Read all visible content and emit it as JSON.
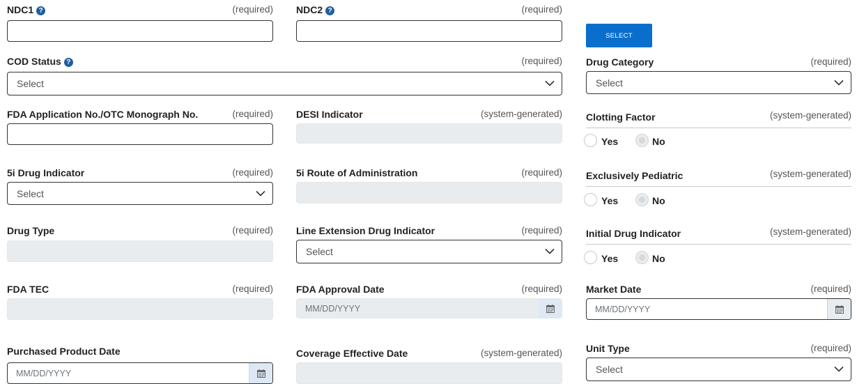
{
  "fields": {
    "ndc1": {
      "label": "NDC1",
      "req": "(required)",
      "value": ""
    },
    "ndc2": {
      "label": "NDC2",
      "req": "(required)",
      "value": ""
    },
    "select_button": "SELECT",
    "cod_status": {
      "label": "COD Status",
      "req": "(required)",
      "selected": "Select"
    },
    "drug_category": {
      "label": "Drug Category",
      "req": "(required)",
      "selected": "Select"
    },
    "fda_app_no": {
      "label": "FDA Application No./OTC Monograph No.",
      "req": "(required)",
      "value": ""
    },
    "desi_indicator": {
      "label": "DESI Indicator",
      "req": "(system-generated)"
    },
    "clotting_factor": {
      "label": "Clotting Factor",
      "req": "(system-generated)",
      "yes": "Yes",
      "no": "No"
    },
    "five_i_drug": {
      "label": "5i Drug Indicator",
      "req": "(required)",
      "selected": "Select"
    },
    "five_i_route": {
      "label": "5i Route of Administration",
      "req": "(required)"
    },
    "excl_pediatric": {
      "label": "Exclusively Pediatric",
      "req": "(system-generated)",
      "yes": "Yes",
      "no": "No"
    },
    "drug_type": {
      "label": "Drug Type",
      "req": "(required)"
    },
    "line_extension": {
      "label": "Line Extension Drug Indicator",
      "req": "(required)",
      "selected": "Select"
    },
    "initial_drug": {
      "label": "Initial Drug Indicator",
      "req": "(system-generated)",
      "yes": "Yes",
      "no": "No"
    },
    "fda_tec": {
      "label": "FDA TEC",
      "req": "(required)"
    },
    "fda_approval_date": {
      "label": "FDA Approval Date",
      "req": "(required)",
      "placeholder": "MM/DD/YYYY"
    },
    "market_date": {
      "label": "Market Date",
      "req": "(required)",
      "placeholder": "MM/DD/YYYY"
    },
    "purchased_product_date": {
      "label": "Purchased Product Date",
      "placeholder": "MM/DD/YYYY"
    },
    "coverage_effective_date": {
      "label": "Coverage Effective Date",
      "req": "(system-generated)"
    },
    "unit_type": {
      "label": "Unit Type",
      "req": "(required)",
      "selected": "Select"
    }
  },
  "colors": {
    "accent": "#0a6fcc",
    "help_icon": "#1f5f9e",
    "disabled_bg": "#e9ecef"
  },
  "icons": [
    "help-icon",
    "chevron-down-icon",
    "calendar-icon"
  ]
}
